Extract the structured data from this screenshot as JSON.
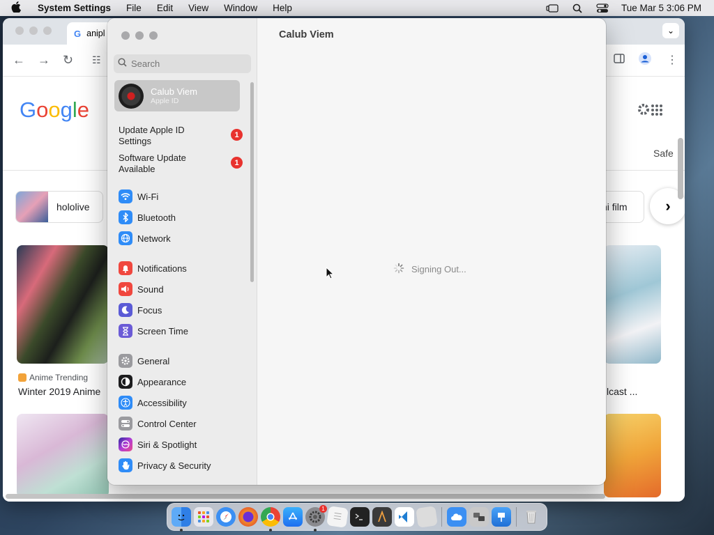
{
  "menubar": {
    "app_name": "System Settings",
    "menus": [
      "File",
      "Edit",
      "View",
      "Window",
      "Help"
    ],
    "datetime": "Tue Mar 5  3:06 PM"
  },
  "chrome": {
    "tab_title": "anipl",
    "chips": [
      "hololive",
      "hi film"
    ],
    "right_partial_text": "Safe",
    "card_source": "Anime Trending",
    "card_title_left": "Winter 2019 Anime",
    "card_title_right": "lcast ..."
  },
  "settings": {
    "search_placeholder": "Search",
    "account": {
      "name": "Calub Viem",
      "subtitle": "Apple ID"
    },
    "notices": [
      {
        "label": "Update Apple ID Settings",
        "badge": "1"
      },
      {
        "label": "Software Update Available",
        "badge": "1"
      }
    ],
    "items": [
      {
        "label": "Wi-Fi",
        "icon": "wifi-icon",
        "color": "#2f8cf7"
      },
      {
        "label": "Bluetooth",
        "icon": "bluetooth-icon",
        "color": "#2f8cf7"
      },
      {
        "label": "Network",
        "icon": "globe-icon",
        "color": "#2f8cf7"
      },
      {
        "label": "Notifications",
        "icon": "bell-icon",
        "color": "#f0473e"
      },
      {
        "label": "Sound",
        "icon": "speaker-icon",
        "color": "#f0473e"
      },
      {
        "label": "Focus",
        "icon": "moon-icon",
        "color": "#5b5bd6"
      },
      {
        "label": "Screen Time",
        "icon": "hourglass-icon",
        "color": "#6b5bd6"
      },
      {
        "label": "General",
        "icon": "gear-icon",
        "color": "#9a9a9e"
      },
      {
        "label": "Appearance",
        "icon": "appearance-icon",
        "color": "#1c1c1e"
      },
      {
        "label": "Accessibility",
        "icon": "accessibility-icon",
        "color": "#2f8cf7"
      },
      {
        "label": "Control Center",
        "icon": "toggles-icon",
        "color": "#9a9a9e"
      },
      {
        "label": "Siri & Spotlight",
        "icon": "siri-icon",
        "color": "#9a3bd6"
      },
      {
        "label": "Privacy & Security",
        "icon": "hand-icon",
        "color": "#2f8cf7"
      }
    ],
    "main_title": "Calub Viem",
    "status_text": "Signing Out..."
  },
  "dock": {
    "apps": [
      {
        "name": "finder-icon",
        "color": "#3a8ef0"
      },
      {
        "name": "launchpad-icon",
        "color": "#e8e8ee"
      },
      {
        "name": "safari-icon",
        "color": "#3b8ff3"
      },
      {
        "name": "firefox-icon",
        "color": "#e7602b"
      },
      {
        "name": "chrome-icon",
        "color": "#ffffff"
      },
      {
        "name": "app-store-icon",
        "color": "#1e8ef5"
      },
      {
        "name": "system-settings-icon",
        "color": "#8a8a8e",
        "badge": "1"
      },
      {
        "name": "textedit-icon",
        "color": "#f4f4f4"
      },
      {
        "name": "terminal-icon",
        "color": "#222222"
      },
      {
        "name": "instruments-icon",
        "color": "#3a3a3a"
      },
      {
        "name": "vscode-icon",
        "color": "#1f7ed3"
      },
      {
        "name": "preview-icon",
        "color": "#dcdcdc"
      }
    ],
    "recent": [
      {
        "name": "icloud-icon",
        "color": "#3b8ff3"
      },
      {
        "name": "migration-icon",
        "color": "#c9c9c9"
      },
      {
        "name": "keynote-icon",
        "color": "#2f8cf7"
      }
    ],
    "trash": "trash-icon"
  }
}
